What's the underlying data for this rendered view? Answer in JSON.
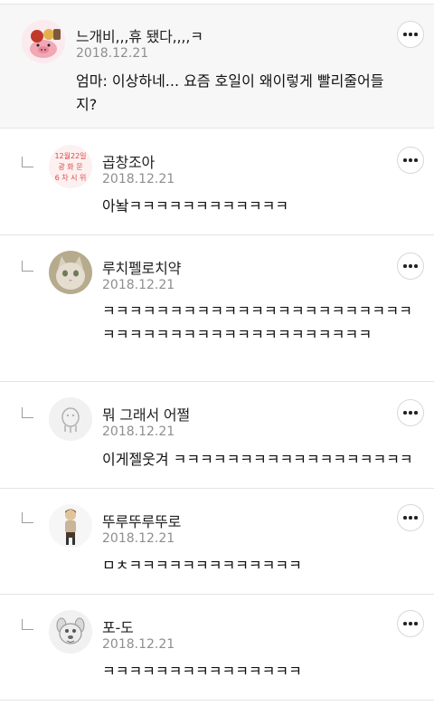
{
  "comments": [
    {
      "nickname": "느개비,,,휴 됐다,,,,ㅋ",
      "date": "2018.12.21",
      "text": "엄마: 이상하네... 요즘 호일이 왜이렇게 빨리줄어들지?",
      "avatar_icon": "pig-character-icon"
    },
    {
      "nickname": "곱창조아",
      "date": "2018.12.21",
      "text": "아놬ㅋㅋㅋㅋㅋㅋㅋㅋㅋㅋㅋㅋ",
      "avatar_icon": "red-text-stamp-icon",
      "avatar_text": [
        "12월22일",
        "광 화 문",
        "6 차 시 위"
      ]
    },
    {
      "nickname": "루치펠로치약",
      "date": "2018.12.21",
      "text": "ㅋㅋㅋㅋㅋㅋㅋㅋㅋㅋㅋㅋㅋㅋㅋㅋㅋㅋㅋㅋㅋㅋㅋㅋㅋㅋㅋㅋㅋㅋㅋㅋㅋㅋㅋㅋㅋㅋㅋㅋㅋㅋㅋ",
      "avatar_icon": "cat-photo-icon"
    },
    {
      "nickname": "뭐 그래서 어쩔",
      "date": "2018.12.21",
      "text": "이게젤웃겨 ㅋㅋㅋㅋㅋㅋㅋㅋㅋㅋㅋㅋㅋㅋㅋㅋㅋㅋ",
      "avatar_icon": "default-character-icon"
    },
    {
      "nickname": "뚜루뚜루뚜로",
      "date": "2018.12.21",
      "text": "ㅁㅊㅋㅋㅋㅋㅋㅋㅋㅋㅋㅋㅋㅋㅋ",
      "avatar_icon": "person-figure-icon"
    },
    {
      "nickname": "포-도",
      "date": "2018.12.21",
      "text": "ㅋㅋㅋㅋㅋㅋㅋㅋㅋㅋㅋㅋㅋㅋㅋ",
      "avatar_icon": "dog-character-icon"
    }
  ],
  "colors": {
    "stamp_red": "#d94a4a",
    "top_comment_bg": "#f7f7f7",
    "divider": "#e4e4e4"
  }
}
